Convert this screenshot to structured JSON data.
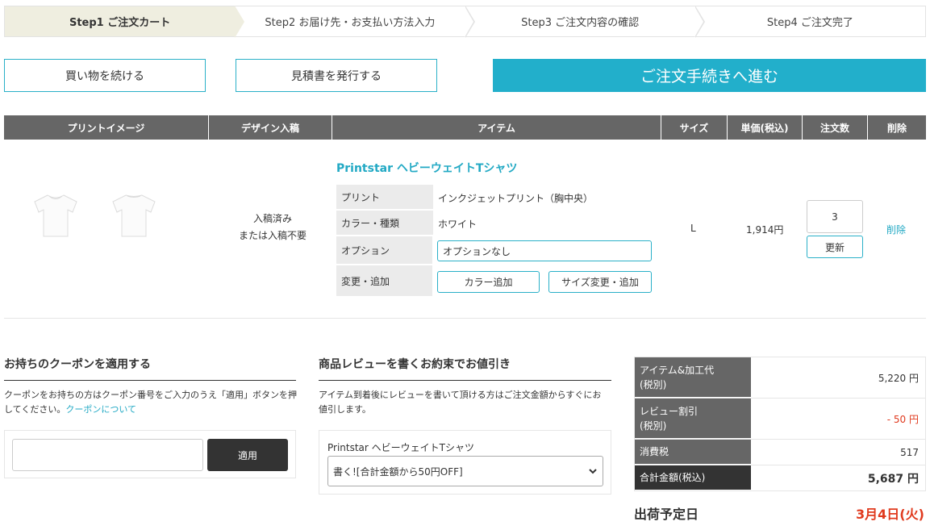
{
  "steps": [
    "Step1 ご注文カート",
    "Step2 お届け先・お支払い方法入力",
    "Step3 ご注文内容の確認",
    "Step4 ご注文完了"
  ],
  "buttons": {
    "continue_shopping": "買い物を続ける",
    "quote": "見積書を発行する",
    "checkout": "ご注文手続きへ進む"
  },
  "table": {
    "headers": [
      "プリントイメージ",
      "デザイン入稿",
      "アイテム",
      "サイズ",
      "単価(税込)",
      "注文数",
      "削除"
    ],
    "row": {
      "design_status_1": "入稿済み",
      "design_status_2": "または入稿不要",
      "item_name": "Printstar ヘビーウェイトTシャツ",
      "details": {
        "print_label": "プリント",
        "print_value": "インクジェットプリント（胸中央）",
        "color_label": "カラー・種類",
        "color_value": "ホワイト",
        "option_label": "オプション",
        "option_value": "オプションなし",
        "change_label": "変更・追加",
        "add_color": "カラー追加",
        "change_size": "サイズ変更・追加"
      },
      "size": "L",
      "price": "1,914円",
      "quantity": "3",
      "update": "更新",
      "delete": "削除"
    }
  },
  "coupon": {
    "title": "お持ちのクーポンを適用する",
    "text": "クーポンをお持ちの方はクーポン番号をご入力のうえ「適用」ボタンを押してください。",
    "link": "クーポンについて",
    "apply": "適用"
  },
  "review": {
    "title": "商品レビューを書くお約束でお値引き",
    "text_1": "アイテム到着後にレビューを書いて頂ける方はご注文金額からすぐにお",
    "text_2": "値引します。",
    "product": "Printstar ヘビーウェイトTシャツ",
    "selected": "書く![合計金額から50円OFF]"
  },
  "summary": {
    "items_label_1": "アイテム&加工代",
    "items_label_2": "(税別)",
    "items_value": "5,220 円",
    "review_label_1": "レビュー割引",
    "review_label_2": "(税別)",
    "review_value": "- 50 円",
    "tax_label": "消費税",
    "tax_value": "517",
    "total_label": "合計金額(税込)",
    "total_value": "5,687 円"
  },
  "shipping": {
    "label": "出荷予定日",
    "date": "3月4日(火)"
  },
  "colors": {
    "accent": "#22afcb",
    "discount": "#e03a1e",
    "header_bg": "#666666"
  }
}
